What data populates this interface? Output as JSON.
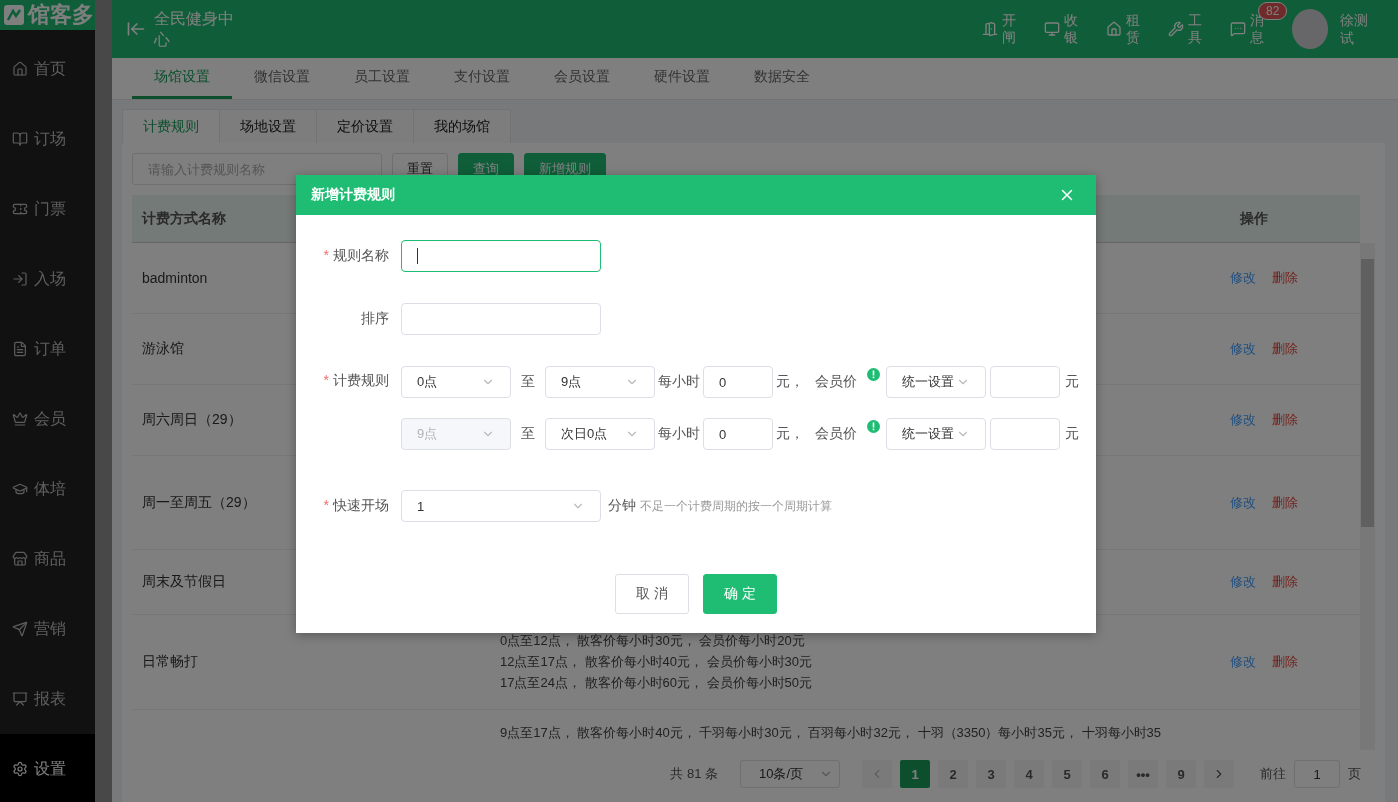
{
  "sidebar": {
    "logo": "馆客多",
    "items": [
      {
        "label": "首页",
        "selected": false
      },
      {
        "label": "订场",
        "selected": false
      },
      {
        "label": "门票",
        "selected": false
      },
      {
        "label": "入场",
        "selected": false
      },
      {
        "label": "订单",
        "selected": false
      },
      {
        "label": "会员",
        "selected": false
      },
      {
        "label": "体培",
        "selected": false
      },
      {
        "label": "商品",
        "selected": false
      },
      {
        "label": "营销",
        "selected": false
      },
      {
        "label": "报表",
        "selected": false
      },
      {
        "label": "设置",
        "selected": true
      }
    ]
  },
  "header": {
    "venue": "全民健身中心",
    "actions": [
      {
        "label": "开闸"
      },
      {
        "label": "收银"
      },
      {
        "label": "租赁"
      },
      {
        "label": "工具"
      },
      {
        "label": "消息",
        "badge": "82"
      }
    ],
    "user": "徐测试"
  },
  "top_tabs": [
    {
      "label": "场馆设置",
      "selected": true
    },
    {
      "label": "微信设置",
      "selected": false
    },
    {
      "label": "员工设置",
      "selected": false
    },
    {
      "label": "支付设置",
      "selected": false
    },
    {
      "label": "会员设置",
      "selected": false
    },
    {
      "label": "硬件设置",
      "selected": false
    },
    {
      "label": "数据安全",
      "selected": false
    }
  ],
  "sub_tabs": [
    {
      "label": "计费规则",
      "selected": true
    },
    {
      "label": "场地设置",
      "selected": false
    },
    {
      "label": "定价设置",
      "selected": false
    },
    {
      "label": "我的场馆",
      "selected": false
    }
  ],
  "filter": {
    "placeholder": "请输入计费规则名称",
    "buttons": [
      {
        "label": "重置",
        "kind": "plain"
      },
      {
        "label": "查询",
        "kind": "primary"
      },
      {
        "label": "新增规则",
        "kind": "primary"
      }
    ]
  },
  "table": {
    "columns": [
      "计费方式名称",
      "操作"
    ],
    "rows": [
      {
        "name": "badminton",
        "actions": [
          "修改",
          "删除"
        ]
      },
      {
        "name": "游泳馆",
        "actions": [
          "修改",
          "删除"
        ]
      },
      {
        "name": "周六周日（29）",
        "actions": [
          "修改",
          "删除"
        ]
      },
      {
        "name": "周一至周五（29）",
        "actions": [
          "修改",
          "删除"
        ]
      },
      {
        "name": "周末及节假日",
        "actions": [
          "修改",
          "删除"
        ]
      },
      {
        "name": "日常畅打",
        "rules": [
          "0点至12点， 散客价每小时30元， 会员价每小时20元",
          "12点至17点， 散客价每小时40元， 会员价每小时30元",
          "17点至24点， 散客价每小时60元， 会员价每小时50元"
        ],
        "actions": [
          "修改",
          "删除"
        ]
      },
      {
        "rules": [
          "9点至17点， 散客价每小时40元， 千羽每小时30元， 百羽每小时32元， 十羽（3350）每小时35元， 十羽每小时35"
        ]
      }
    ]
  },
  "pagination": {
    "total": "共 81 条",
    "page_size": "10条/页",
    "pages": [
      {
        "label": "1",
        "selected": true
      },
      {
        "label": "2",
        "selected": false
      },
      {
        "label": "3",
        "selected": false
      },
      {
        "label": "4",
        "selected": false
      },
      {
        "label": "5",
        "selected": false
      },
      {
        "label": "6",
        "selected": false
      },
      {
        "label": "•••",
        "selected": false
      },
      {
        "label": "9",
        "selected": false
      }
    ],
    "goto_label": "前往",
    "goto_value": "1",
    "unit": "页"
  },
  "dialog": {
    "title": "新增计费规则",
    "name_field": {
      "label": "规则名称",
      "required_mark": "*",
      "focused": true
    },
    "sort_field": {
      "label": "排序",
      "focused": false
    },
    "rules": {
      "label": "计费规则",
      "required_mark": "*",
      "rows": [
        {
          "from": "0点",
          "from_disabled": false,
          "sep": "至",
          "to": "9点",
          "per_hour": "每小时",
          "price": "0",
          "yuan": "元，",
          "member_label": "会员价",
          "member_mode": "统一设置",
          "unit": "元"
        },
        {
          "from": "9点",
          "from_disabled": true,
          "sep": "至",
          "to": "次日0点",
          "per_hour": "每小时",
          "price": "0",
          "yuan": "元，",
          "member_label": "会员价",
          "member_mode": "统一设置",
          "unit": "元"
        }
      ]
    },
    "fast_open": {
      "label": "快速开场",
      "required_mark": "*",
      "value": "1",
      "unit": "分钟",
      "hint": "不足一个计费周期的按一个周期计算"
    },
    "buttons": [
      {
        "label": "取 消",
        "kind": "plain"
      },
      {
        "label": "确 定",
        "kind": "primary"
      }
    ]
  }
}
